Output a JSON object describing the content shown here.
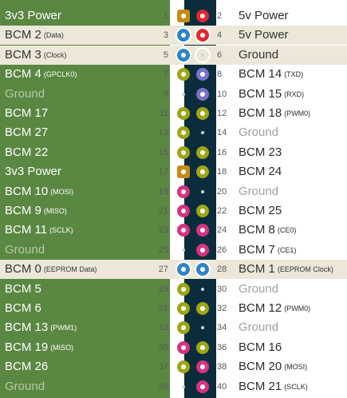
{
  "pins": [
    {
      "l": {
        "n": "1",
        "label": "3v3 Power",
        "sub": "",
        "type": "3v3"
      },
      "r": {
        "n": "2",
        "label": "5v Power",
        "sub": "",
        "type": "5v"
      },
      "hl": false
    },
    {
      "l": {
        "n": "3",
        "label": "BCM 2",
        "sub": "(Data)",
        "type": "i2c"
      },
      "r": {
        "n": "4",
        "label": "5v Power",
        "sub": "",
        "type": "5v"
      },
      "hl": true
    },
    {
      "l": {
        "n": "5",
        "label": "BCM 3",
        "sub": "(Clock)",
        "type": "i2c"
      },
      "r": {
        "n": "6",
        "label": "Ground",
        "sub": "",
        "type": "gnd"
      },
      "hl": true
    },
    {
      "l": {
        "n": "7",
        "label": "BCM 4",
        "sub": "(GPCLK0)",
        "type": "gpio"
      },
      "r": {
        "n": "8",
        "label": "BCM 14",
        "sub": "(TXD)",
        "type": "uart"
      },
      "hl": false
    },
    {
      "l": {
        "n": "9",
        "label": "Ground",
        "sub": "",
        "type": "gnd"
      },
      "r": {
        "n": "10",
        "label": "BCM 15",
        "sub": "(RXD)",
        "type": "uart"
      },
      "hl": false
    },
    {
      "l": {
        "n": "11",
        "label": "BCM 17",
        "sub": "",
        "type": "gpio"
      },
      "r": {
        "n": "12",
        "label": "BCM 18",
        "sub": "(PWM0)",
        "type": "gpio"
      },
      "hl": false
    },
    {
      "l": {
        "n": "13",
        "label": "BCM 27",
        "sub": "",
        "type": "gpio"
      },
      "r": {
        "n": "14",
        "label": "Ground",
        "sub": "",
        "type": "gnd"
      },
      "hl": false
    },
    {
      "l": {
        "n": "15",
        "label": "BCM 22",
        "sub": "",
        "type": "gpio"
      },
      "r": {
        "n": "16",
        "label": "BCM 23",
        "sub": "",
        "type": "gpio"
      },
      "hl": false
    },
    {
      "l": {
        "n": "17",
        "label": "3v3 Power",
        "sub": "",
        "type": "3v3"
      },
      "r": {
        "n": "18",
        "label": "BCM 24",
        "sub": "",
        "type": "gpio"
      },
      "hl": false
    },
    {
      "l": {
        "n": "19",
        "label": "BCM 10",
        "sub": "(MOSI)",
        "type": "spi"
      },
      "r": {
        "n": "20",
        "label": "Ground",
        "sub": "",
        "type": "gnd"
      },
      "hl": false
    },
    {
      "l": {
        "n": "21",
        "label": "BCM 9",
        "sub": "(MISO)",
        "type": "spi"
      },
      "r": {
        "n": "22",
        "label": "BCM 25",
        "sub": "",
        "type": "gpio"
      },
      "hl": false
    },
    {
      "l": {
        "n": "23",
        "label": "BCM 11",
        "sub": "(SCLK)",
        "type": "spi"
      },
      "r": {
        "n": "24",
        "label": "BCM 8",
        "sub": "(CE0)",
        "type": "spi"
      },
      "hl": false
    },
    {
      "l": {
        "n": "25",
        "label": "Ground",
        "sub": "",
        "type": "gnd"
      },
      "r": {
        "n": "26",
        "label": "BCM 7",
        "sub": "(CE1)",
        "type": "spi"
      },
      "hl": false
    },
    {
      "l": {
        "n": "27",
        "label": "BCM 0",
        "sub": "(EEPROM Data)",
        "type": "eeprom"
      },
      "r": {
        "n": "28",
        "label": "BCM 1",
        "sub": "(EEPROM Clock)",
        "type": "eeprom"
      },
      "hl": true
    },
    {
      "l": {
        "n": "29",
        "label": "BCM 5",
        "sub": "",
        "type": "gpio"
      },
      "r": {
        "n": "30",
        "label": "Ground",
        "sub": "",
        "type": "gnd"
      },
      "hl": false
    },
    {
      "l": {
        "n": "31",
        "label": "BCM 6",
        "sub": "",
        "type": "gpio"
      },
      "r": {
        "n": "32",
        "label": "BCM 12",
        "sub": "(PWM0)",
        "type": "gpio"
      },
      "hl": false
    },
    {
      "l": {
        "n": "33",
        "label": "BCM 13",
        "sub": "(PWM1)",
        "type": "gpio"
      },
      "r": {
        "n": "34",
        "label": "Ground",
        "sub": "",
        "type": "gnd"
      },
      "hl": false
    },
    {
      "l": {
        "n": "35",
        "label": "BCM 19",
        "sub": "(MISO)",
        "type": "spi"
      },
      "r": {
        "n": "36",
        "label": "BCM 16",
        "sub": "",
        "type": "gpio"
      },
      "hl": false
    },
    {
      "l": {
        "n": "37",
        "label": "BCM 26",
        "sub": "",
        "type": "gpio"
      },
      "r": {
        "n": "38",
        "label": "BCM 20",
        "sub": "(MOSI)",
        "type": "spi"
      },
      "hl": false
    },
    {
      "l": {
        "n": "39",
        "label": "Ground",
        "sub": "",
        "type": "gnd"
      },
      "r": {
        "n": "40",
        "label": "BCM 21",
        "sub": "(SCLK)",
        "type": "spi"
      },
      "hl": false
    }
  ],
  "colors": {
    "board_green": "#5a8741",
    "header_dark": "#0b2d3b",
    "power_3v3": "#c58c15",
    "power_5v": "#e0282f",
    "gpio": "#9ea616",
    "i2c": "#2e85c8",
    "uart": "#7772c8",
    "spi": "#d63383",
    "highlight": "#ece7d8"
  }
}
